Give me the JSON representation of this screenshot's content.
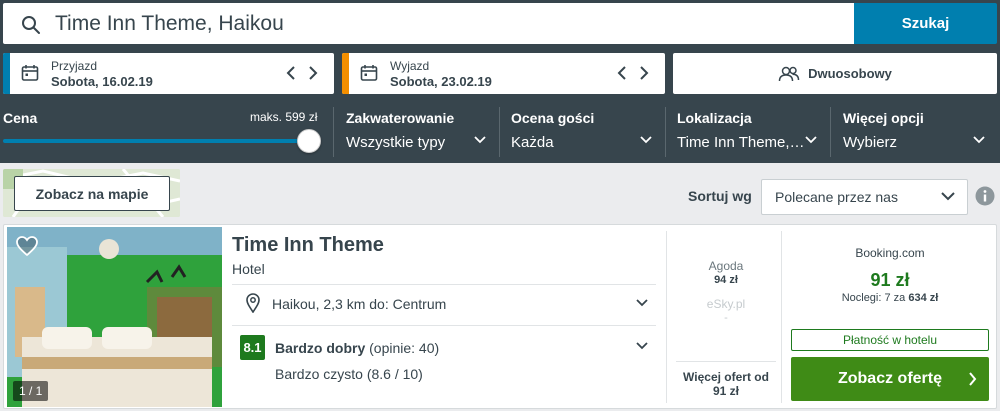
{
  "search": {
    "value": "Time Inn Theme, Haikou",
    "button": "Szukaj"
  },
  "checkin": {
    "label": "Przyjazd",
    "value": "Sobota, 16.02.19",
    "accent": "#007faf"
  },
  "checkout": {
    "label": "Wyjazd",
    "value": "Sobota, 23.02.19",
    "accent": "#f48f00"
  },
  "room": {
    "label": "Dwuosobowy"
  },
  "filters": {
    "price": {
      "title": "Cena",
      "max": "maks. 599 zł",
      "level": 1.0
    },
    "accommodation": {
      "title": "Zakwaterowanie",
      "value": "Wszystkie typy"
    },
    "rating": {
      "title": "Ocena gości",
      "value": "Każda"
    },
    "location": {
      "title": "Lokalizacja",
      "value": "Time Inn Theme,…"
    },
    "more": {
      "title": "Więcej opcji",
      "value": "Wybierz"
    }
  },
  "map_button": "Zobacz na mapie",
  "sort": {
    "label": "Sortuj wg",
    "value": "Polecane przez nas"
  },
  "result": {
    "photo_counter": "1 / 1",
    "name": "Time Inn Theme",
    "type": "Hotel",
    "location": "Haikou, 2,3 km do: Centrum",
    "rating_score": "8.1",
    "rating_label": "Bardzo dobry",
    "rating_count": "(opinie: 40)",
    "cleanliness": "Bardzo czysto (8.6 / 10)",
    "partners": [
      {
        "name": "Agoda",
        "price": "94 zł"
      },
      {
        "name": "eSky.pl",
        "price": "-"
      }
    ],
    "more_offers_line1": "Więcej ofert od",
    "more_offers_line2": "91 zł",
    "main_partner": "Booking.com",
    "main_price": "91 zł",
    "nights_prefix": "Noclegi: 7 za",
    "nights_total": "634 zł",
    "pay_at_hotel": "Płatność w hotelu",
    "cta": "Zobacz ofertę"
  }
}
